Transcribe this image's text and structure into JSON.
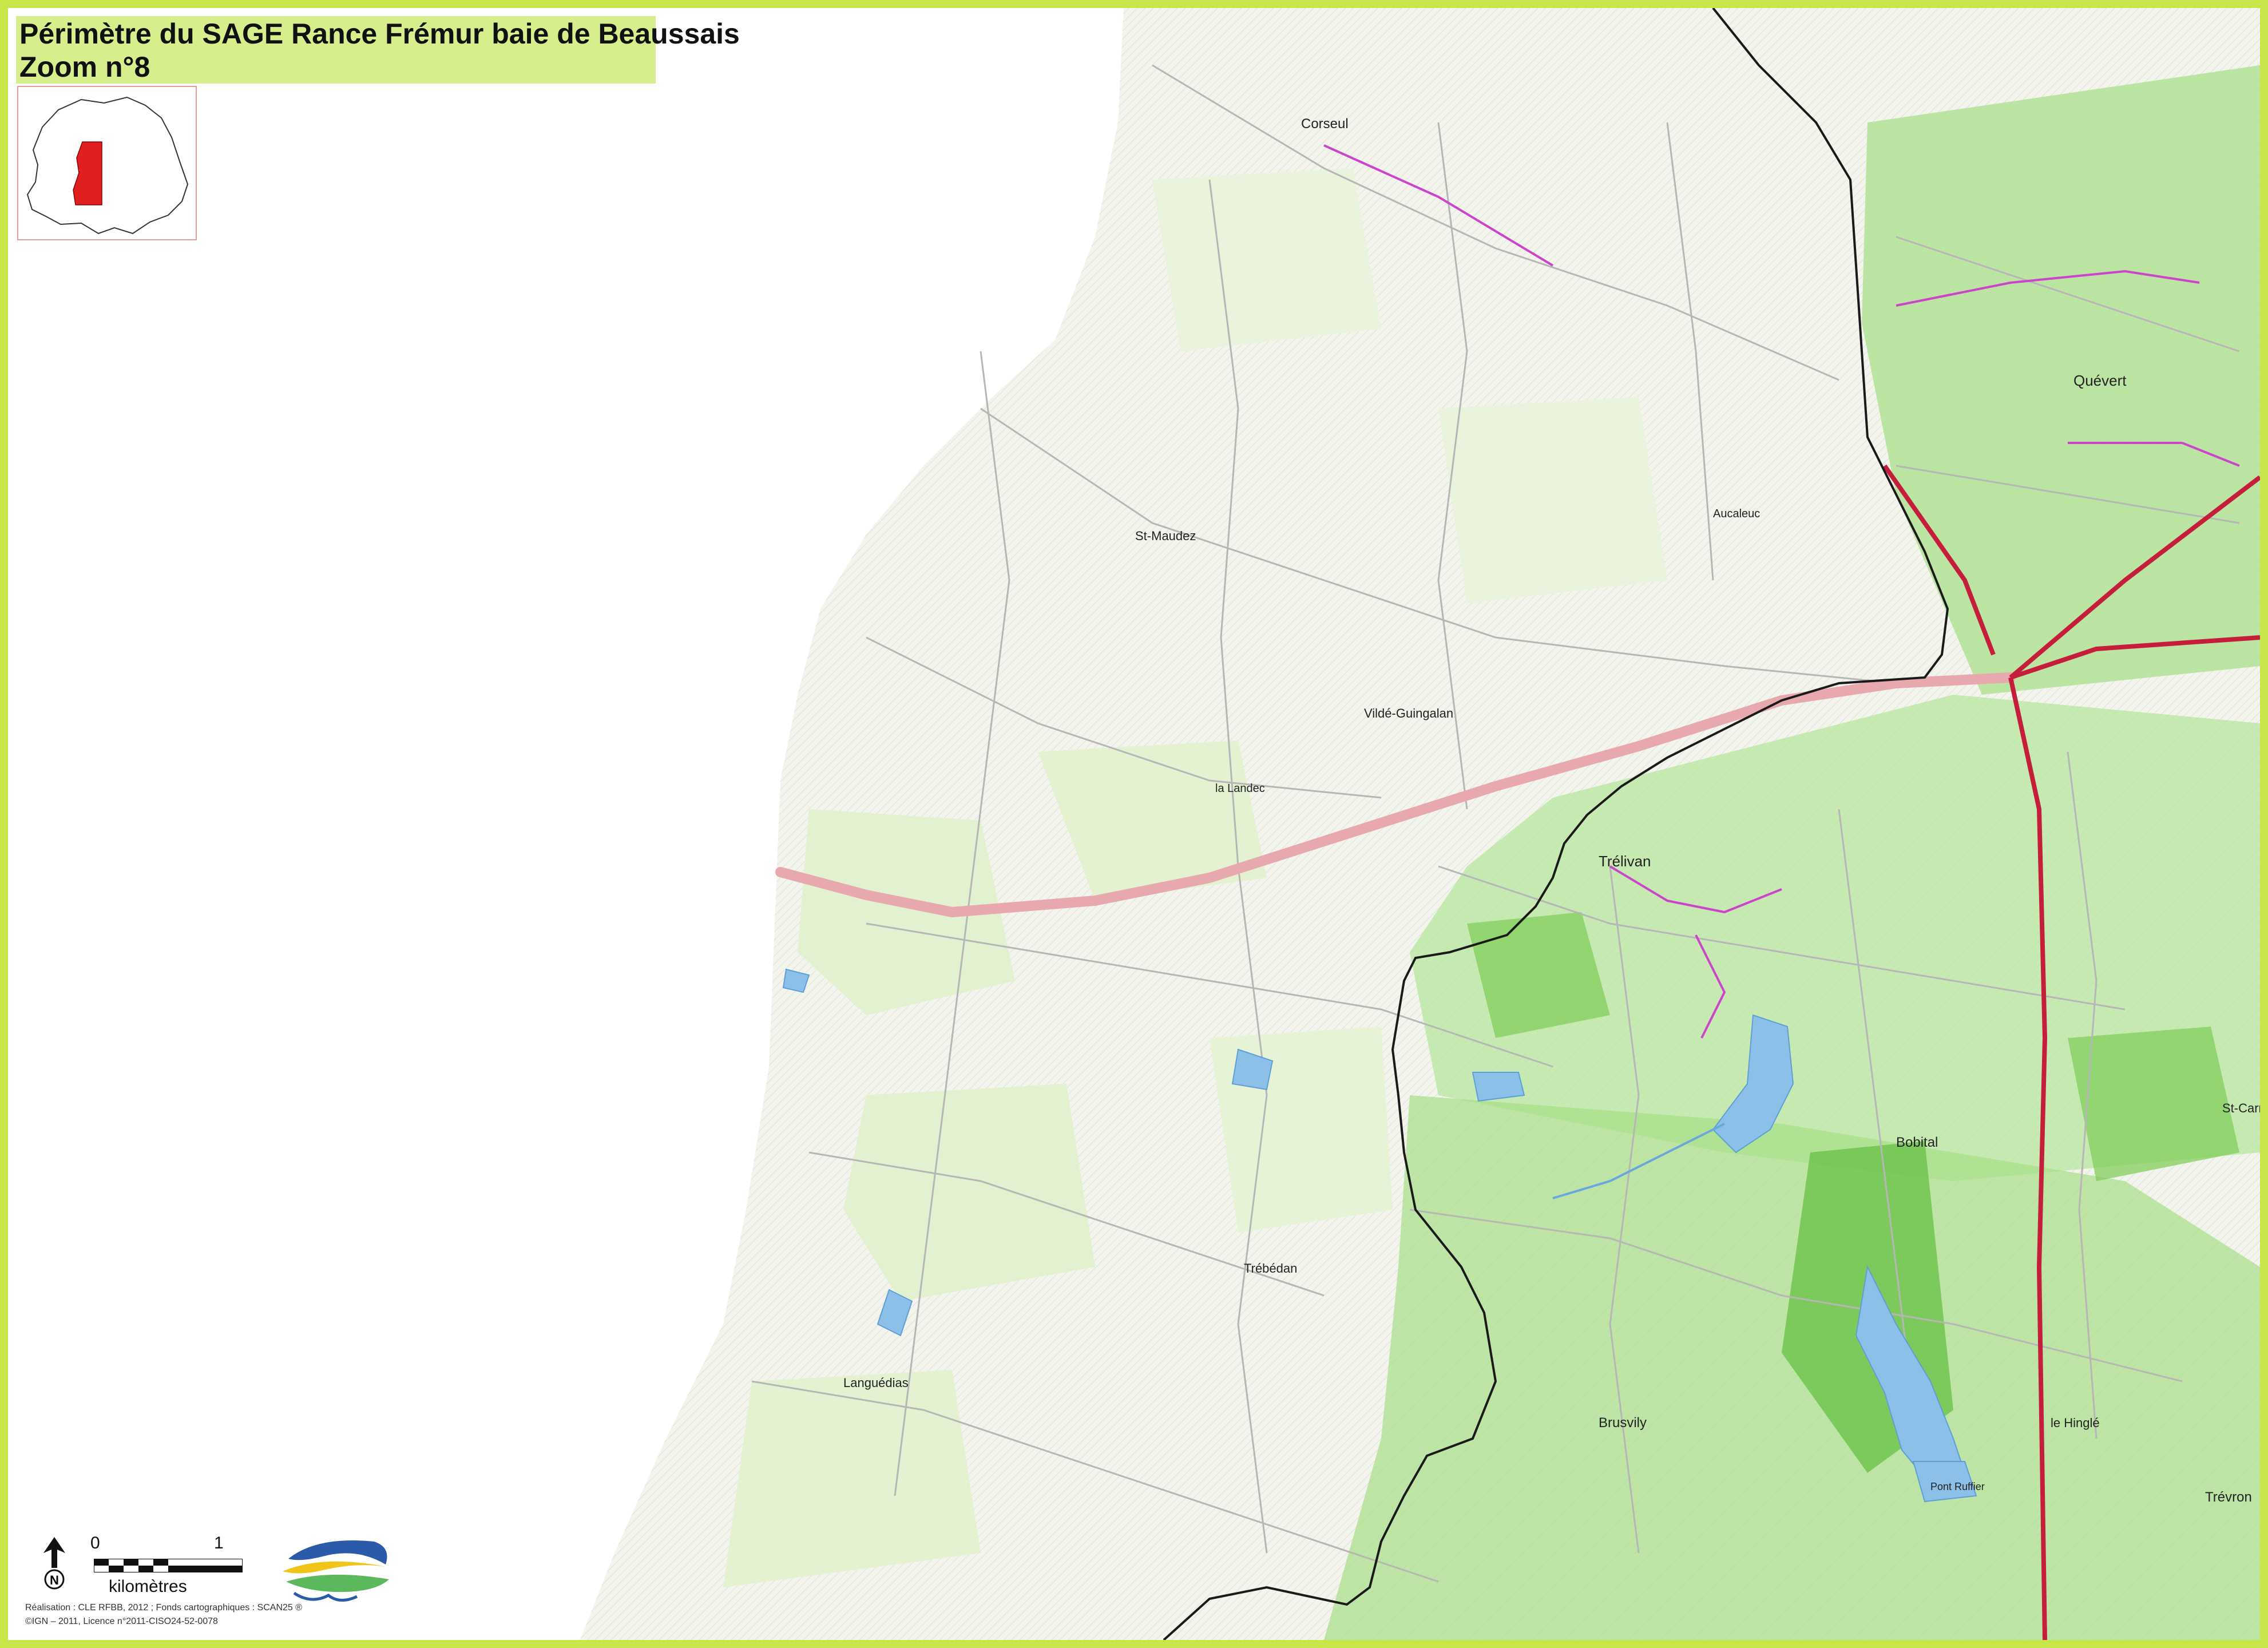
{
  "title": {
    "line1": "Périmètre du SAGE Rance Frémur baie de Beaussais",
    "line2": "Zoom  n°8"
  },
  "towns": [
    "Corseul",
    "Quévert",
    "St-Maudez",
    "Vildé-Guingalan",
    "Trélivan",
    "Bobital",
    "Brusvily",
    "Trébédan",
    "Trévron",
    "la Landec",
    "Languédias",
    "le Hinglé",
    "St-Carné",
    "Aucaleuc",
    "Pont Ruffier"
  ],
  "legend": {
    "north_label": "N",
    "scale_start": "0",
    "scale_end": "1",
    "scale_unit": "kilomètres"
  },
  "credits": {
    "line1": "Réalisation : CLE RFBB, 2012 ; Fonds cartographiques : SCAN25 ®",
    "line2": "©IGN – 2011, Licence n°2011-CISO24-52-0078"
  },
  "colors": {
    "frame": "#c8e64a",
    "title_bg": "#d6ee8c",
    "boundary": "#1a1a1a",
    "highway": "#e8a9ae",
    "main_road": "#c41e3a",
    "local_road": "#cc44cc",
    "water": "#7fb3e0",
    "forest": "#8fd66a",
    "zoom_area": "#e02020"
  }
}
